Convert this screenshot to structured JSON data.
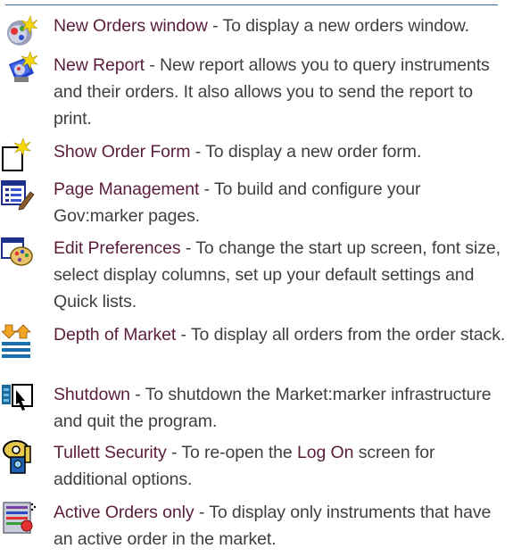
{
  "entries": [
    {
      "icon": "new-orders-window-icon",
      "term": "New Orders window",
      "desc": " - To display a new orders window."
    },
    {
      "icon": "new-report-icon",
      "term": "New Report",
      "desc": " - New report allows you to query instruments and their orders. It also allows you to send the report to print."
    },
    {
      "icon": "show-order-form-icon",
      "term": "Show Order Form",
      "desc": " - To display a new order form."
    },
    {
      "icon": "page-management-icon",
      "term": "Page Management",
      "desc": " - To build and configure your Gov:marker pages."
    },
    {
      "icon": "edit-preferences-icon",
      "term": "Edit Preferences",
      "desc": " - To change the start up screen, font size, select display columns, set up your default settings and Quick lists."
    },
    {
      "icon": "depth-of-market-icon",
      "term": "Depth of Market",
      "desc": " - To display all orders from the order stack."
    },
    {
      "icon": "shutdown-icon",
      "term": "Shutdown",
      "desc": " - To shutdown the Market:marker infrastructure and quit the program."
    },
    {
      "icon": "tullett-security-icon",
      "term": "Tullett Security",
      "desc_a": " - To re-open the ",
      "term_b": "Log On",
      "desc_b": " screen for additional options."
    },
    {
      "icon": "active-orders-icon",
      "term": "Active Orders only",
      "desc": " - To display only instruments that have an active order in the market."
    }
  ]
}
